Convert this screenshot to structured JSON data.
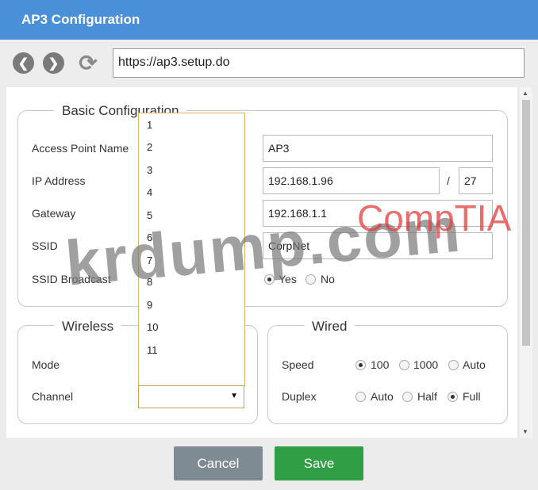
{
  "window": {
    "title": "AP3 Configuration"
  },
  "browser": {
    "url": "https://ap3.setup.do"
  },
  "basic": {
    "legend": "Basic Configuration",
    "ap_name_label": "Access Point Name",
    "ap_name_value": "AP3",
    "ip_label": "IP Address",
    "ip_value": "192.168.1.96",
    "slash": "/",
    "mask_value": "27",
    "gateway_label": "Gateway",
    "gateway_value": "192.168.1.1",
    "ssid_label": "SSID",
    "ssid_value": "CorpNet",
    "broadcast_label": "SSID Broadcast",
    "broadcast_yes": "Yes",
    "broadcast_no": "No"
  },
  "wireless": {
    "legend": "Wireless",
    "mode_label": "Mode",
    "channel_label": "Channel",
    "channel_options": [
      "1",
      "2",
      "3",
      "4",
      "5",
      "6",
      "7",
      "8",
      "9",
      "10",
      "11"
    ]
  },
  "wired": {
    "legend": "Wired",
    "speed_label": "Speed",
    "speed_100": "100",
    "speed_1000": "1000",
    "speed_auto": "Auto",
    "duplex_label": "Duplex",
    "duplex_auto": "Auto",
    "duplex_half": "Half",
    "duplex_full": "Full"
  },
  "footer": {
    "cancel": "Cancel",
    "save": "Save"
  },
  "watermarks": {
    "site": "krdump.com",
    "brand": "CompTIA"
  }
}
